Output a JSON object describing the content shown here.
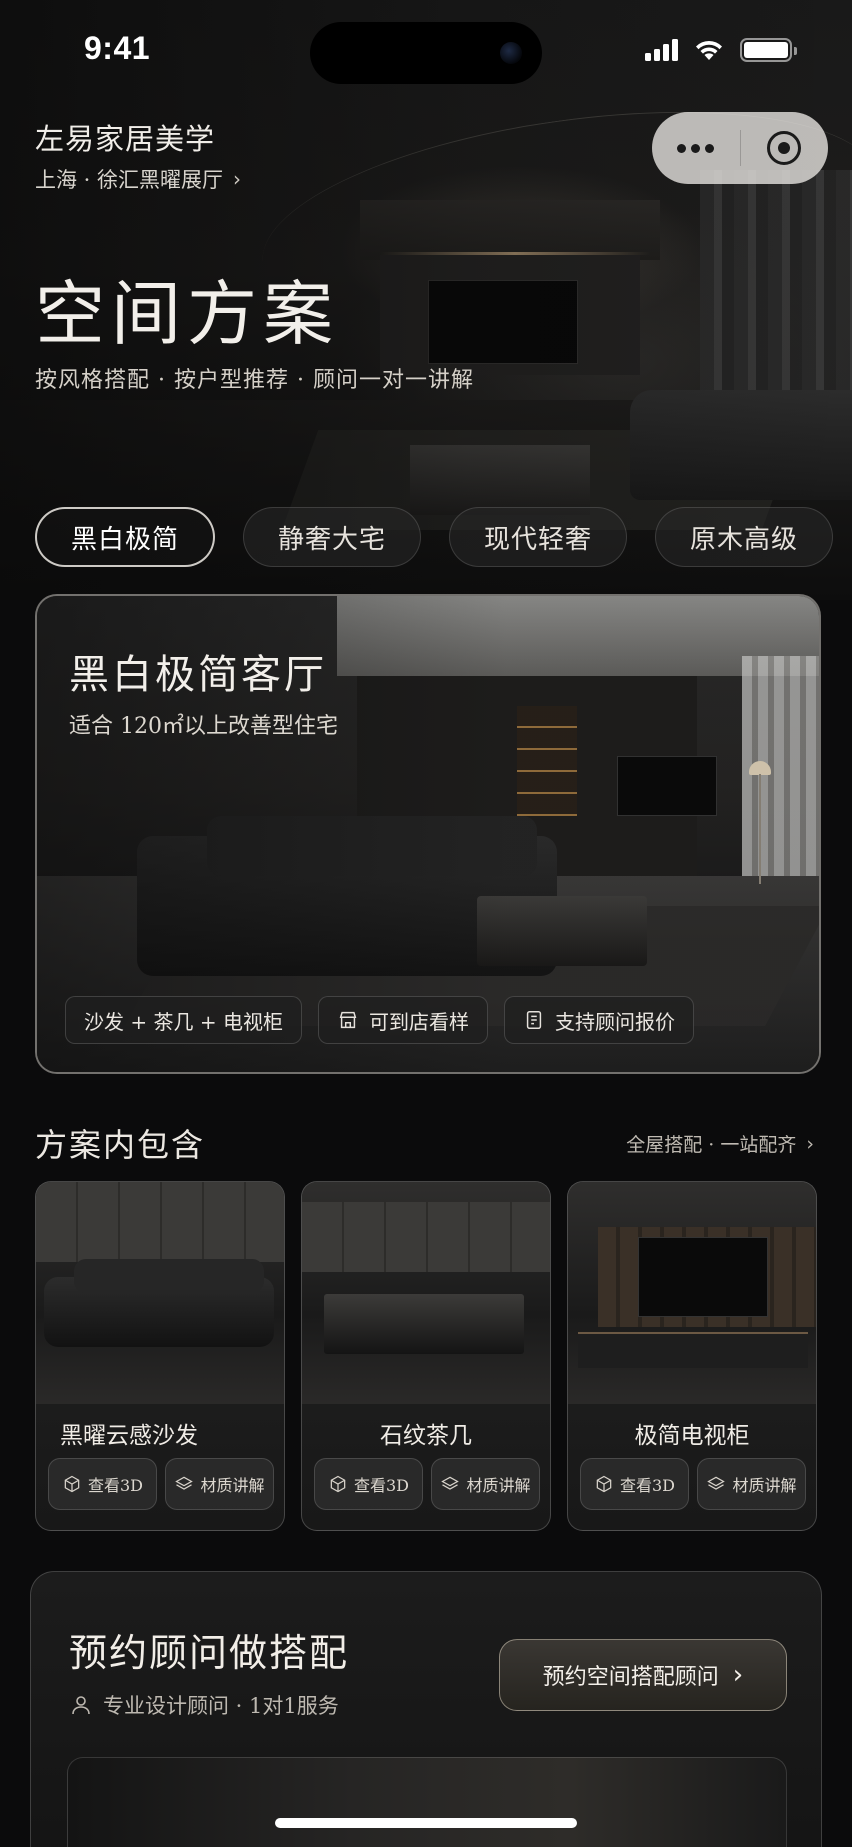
{
  "status_bar": {
    "time": "9:41"
  },
  "header": {
    "brand": "左易家居美学",
    "store": "上海 · 徐汇黑曜展厅",
    "title": "空间方案",
    "subtitle": "按风格搭配 · 按户型推荐 · 顾问一对一讲解"
  },
  "style_tabs": [
    {
      "label": "黑白极简",
      "active": true
    },
    {
      "label": "静奢大宅",
      "active": false
    },
    {
      "label": "现代轻奢",
      "active": false
    },
    {
      "label": "原木高级",
      "active": false
    }
  ],
  "feature": {
    "title": "黑白极简客厅",
    "subtitle": "适合 120㎡以上改善型住宅",
    "chips": [
      {
        "label": "沙发 + 茶几 + 电视柜",
        "icon": ""
      },
      {
        "label": "可到店看样",
        "icon": "store-icon"
      },
      {
        "label": "支持顾问报价",
        "icon": "quote-icon"
      }
    ]
  },
  "includes": {
    "title": "方案内包含",
    "link": "全屋搭配 · 一站配齐",
    "items": [
      {
        "name": "黑曜云感沙发",
        "btn_3d": "查看3D",
        "btn_material": "材质讲解"
      },
      {
        "name": "石纹茶几",
        "btn_3d": "查看3D",
        "btn_material": "材质讲解"
      },
      {
        "name": "极简电视柜",
        "btn_3d": "查看3D",
        "btn_material": "材质讲解"
      }
    ]
  },
  "consult": {
    "title": "预约顾问做搭配",
    "subtitle": "专业设计顾问 · 1对1服务",
    "cta": "预约空间搭配顾问"
  },
  "colors": {
    "background": "#0b0b0c",
    "text_primary": "#f2efea",
    "text_secondary": "#d5d0c8",
    "capsule": "#ebe8e4"
  }
}
